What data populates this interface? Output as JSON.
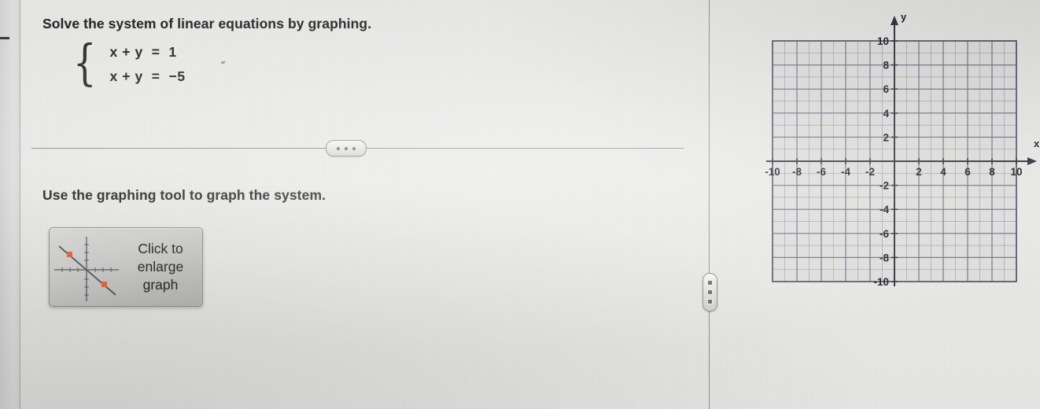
{
  "prompt": "Solve the system of linear equations by graphing.",
  "system": {
    "brace": "{",
    "equations": [
      "x + y  =  1",
      "x + y  =  −5"
    ]
  },
  "instruction": "Use the graphing tool to graph the system.",
  "enlarge_button": {
    "label": "Click to enlarge graph",
    "thumbnail_point_color": "#e8622a",
    "thumbnail_line_color": "#55555a"
  },
  "divider": {
    "ellipsis_label": "•••"
  },
  "splitter": {
    "dots": 3
  },
  "chart_data": {
    "type": "scatter",
    "title": "",
    "xlabel": "x",
    "ylabel": "y",
    "xlim": [
      -10,
      10
    ],
    "ylim": [
      -10,
      10
    ],
    "grid": true,
    "grid_step": 1,
    "tick_step": 2,
    "x_ticks": [
      -10,
      -8,
      -6,
      -4,
      -2,
      2,
      4,
      6,
      8,
      10
    ],
    "y_ticks": [
      10,
      8,
      6,
      4,
      2,
      -2,
      -4,
      -6,
      -8,
      -10
    ],
    "x_tick_labels": [
      "-10",
      "-8",
      "-6",
      "-4",
      "-2",
      "2",
      "4",
      "6",
      "8",
      "10"
    ],
    "y_tick_labels": [
      "10",
      "8",
      "6",
      "4",
      "2",
      "-2",
      "-4",
      "-6",
      "-8",
      "-10"
    ],
    "axis_arrow_labels": {
      "x": "x",
      "y": "y"
    },
    "series": [],
    "annotations": [],
    "legend": null,
    "colors": {
      "grid_line": "#6e6d86",
      "grid_border": "#4b4a5e",
      "axis": "#2f2f3a",
      "tick_text": "#1c1c20",
      "plot_background": "#dcdcda"
    }
  }
}
